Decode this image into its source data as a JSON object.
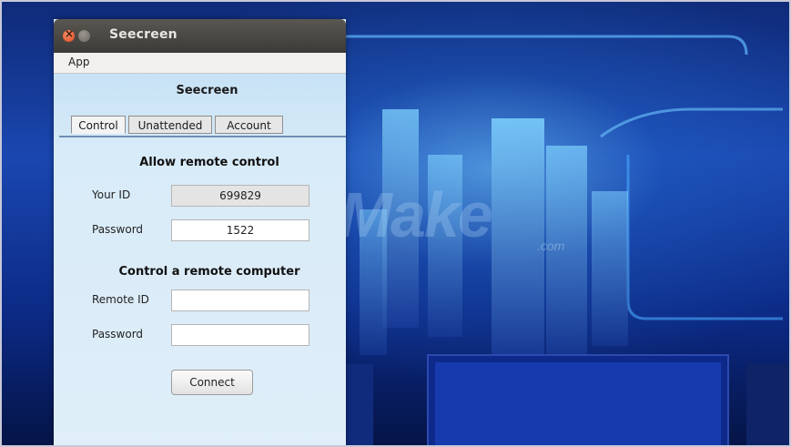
{
  "window": {
    "title": "Seecreen",
    "menu": [
      "App"
    ],
    "app_title": "Seecreen",
    "tabs": [
      {
        "label": "Control",
        "active": true
      },
      {
        "label": "Unattended",
        "active": false
      },
      {
        "label": "Account",
        "active": false
      }
    ]
  },
  "allow_remote": {
    "heading": "Allow remote control",
    "your_id_label": "Your ID",
    "your_id_value": "699829",
    "password_label": "Password",
    "password_value": "1522"
  },
  "control_remote": {
    "heading": "Control a remote computer",
    "remote_id_label": "Remote ID",
    "remote_id_value": "",
    "password_label": "Password",
    "password_value": "",
    "connect_label": "Connect"
  },
  "watermark": {
    "text": "TipsMake",
    "suffix": ".com"
  },
  "colors": {
    "titlebar": "#3c3b37",
    "close": "#e0471f",
    "panel": "#d8e9f6",
    "tab_rule": "#6f8fb2"
  }
}
